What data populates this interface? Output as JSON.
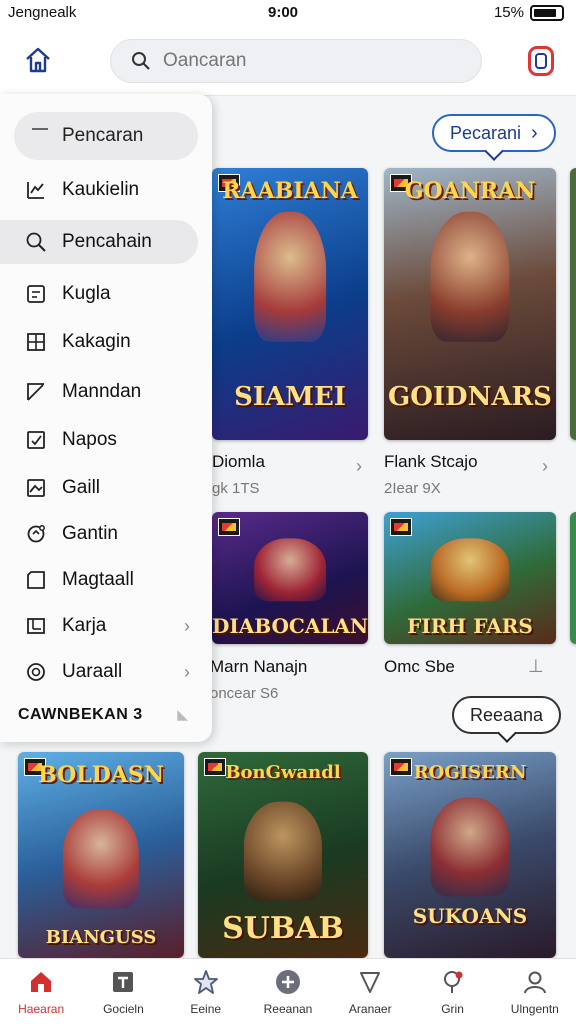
{
  "status_bar": {
    "carrier": "Jengnealk",
    "time": "9:00",
    "battery": "15%"
  },
  "header": {
    "search_placeholder": "Oancaran"
  },
  "content": {
    "top_pill": "Pecarani",
    "mid_pill": "Reeaana",
    "row1": [
      {
        "art_title": "RAABIANA",
        "art_sub": "SIAMEI",
        "name": "Diomla",
        "sub": "gk 1TS"
      },
      {
        "art_title": "GOANRAN",
        "art_sub": "GOIDNARS",
        "name": "Flank Stcajo",
        "sub": "2Iear 9X"
      }
    ],
    "row2": [
      {
        "art_title": "",
        "art_sub": "DIABOCALAN",
        "name": "Marn Nanajn",
        "sub": "oncear S6"
      },
      {
        "art_title": "",
        "art_sub": "FIRH FARS",
        "name": "Omc Sbe",
        "sub": ""
      }
    ],
    "row3": [
      {
        "art_title": "BOLDASN",
        "art_sub": "BIANGUSS"
      },
      {
        "art_title": "BonGwandl",
        "art_sub": "SUBAB"
      },
      {
        "art_title": "ROGISERN",
        "art_sub": "SUKOANS"
      }
    ]
  },
  "drawer": {
    "search_label": "Pencaran",
    "items": [
      {
        "label": "Kaukielin",
        "icon": "chart-icon"
      },
      {
        "label": "Pencahain",
        "icon": "search-icon"
      },
      {
        "label": "Kugla",
        "icon": "calendar-icon"
      },
      {
        "label": "Kakagin",
        "icon": "grid-icon"
      },
      {
        "label": "Manndan",
        "icon": "pencil-icon"
      },
      {
        "label": "Napos",
        "icon": "check-square-icon"
      },
      {
        "label": "Gaill",
        "icon": "image-icon"
      },
      {
        "label": "Gantin",
        "icon": "settings-icon"
      },
      {
        "label": "Magtaall",
        "icon": "tag-icon"
      },
      {
        "label": "Karja",
        "icon": "board-icon"
      },
      {
        "label": "Uaraall",
        "icon": "circle-icon"
      }
    ],
    "footer": "CAWNBEKAN 3"
  },
  "bottom_nav": [
    {
      "label": "Haearan",
      "icon": "home-icon"
    },
    {
      "label": "Gocieln",
      "icon": "tools-icon"
    },
    {
      "label": "Eeine",
      "icon": "star-icon"
    },
    {
      "label": "Reeanan",
      "icon": "plus-icon"
    },
    {
      "label": "Aranaer",
      "icon": "shield-icon"
    },
    {
      "label": "Grin",
      "icon": "pin-icon"
    },
    {
      "label": "Ulngentn",
      "icon": "user-icon"
    }
  ],
  "colors": {
    "accent": "#2a64c8",
    "brand_dark": "#1d3b8f",
    "active_nav": "#d32f2f"
  }
}
